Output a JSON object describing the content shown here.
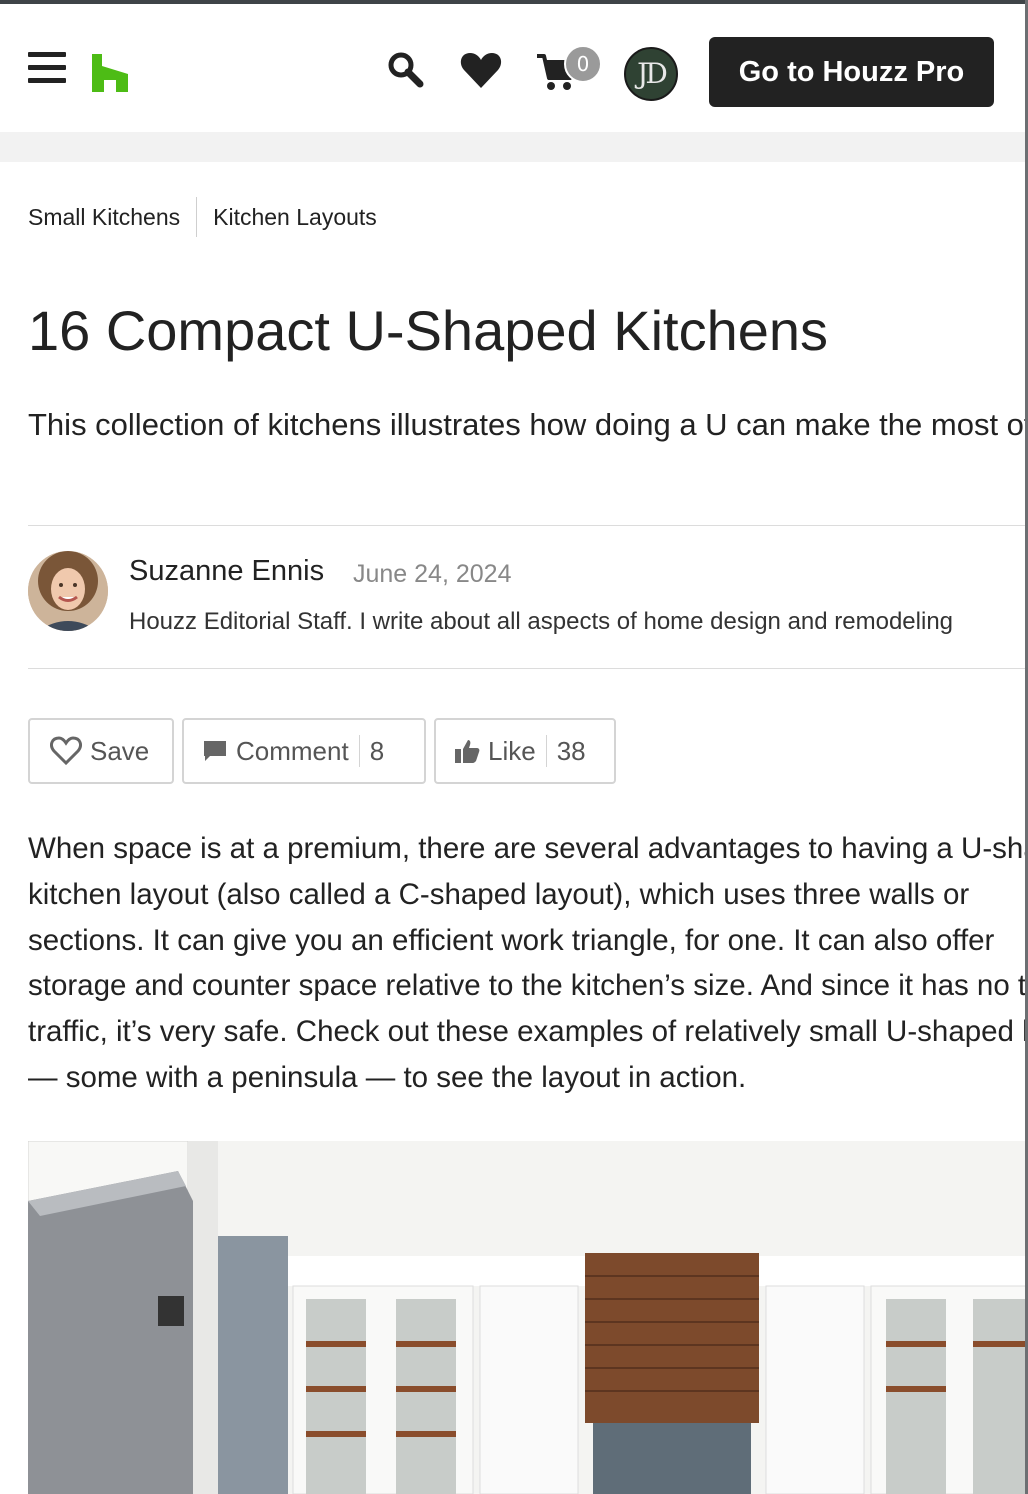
{
  "header": {
    "menu_icon": "hamburger-menu-icon",
    "logo_icon": "houzz-logo-icon",
    "search_icon": "search-icon",
    "saved_icon": "heart-icon",
    "cart_icon": "cart-icon",
    "cart_count": "0",
    "user_initials": "JD",
    "pro_button_label": "Go to Houzz Pro",
    "brand_color": "#4dbc15"
  },
  "breadcrumbs": [
    "Small Kitchens",
    "Kitchen Layouts"
  ],
  "article": {
    "title": "16 Compact U-Shaped Kitchens",
    "subtitle": "This collection of kitchens illustrates how doing a U can make the most of tight quarters",
    "author": {
      "name": "Suzanne Ennis",
      "date": "June 24, 2024",
      "bio": "Houzz Editorial Staff. I write about all aspects of home design and remodeling"
    },
    "actions": {
      "save_label": "Save",
      "comment_label": "Comment",
      "comment_count": "8",
      "like_label": "Like",
      "like_count": "38"
    },
    "body_lines": [
      "When space is at a premium, there are several advantages to having a U-shaped",
      "kitchen layout (also called a C-shaped layout), which uses three walls or",
      "sections. It can give you an efficient work triangle, for one. It can also offer",
      "storage and counter space relative to the kitchen’s size. And since it has no through",
      "traffic, it’s very safe. Check out these examples of relatively small U-shaped kitchens",
      "— some with a peninsula — to see the layout in action."
    ]
  }
}
